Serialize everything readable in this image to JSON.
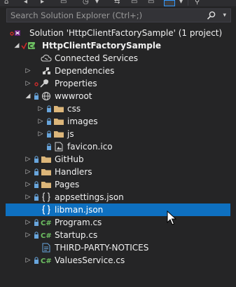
{
  "search": {
    "placeholder": "Search Solution Explorer (Ctrl+;)"
  },
  "tree": {
    "solution": "Solution 'HttpClientFactorySample' (1 project)",
    "project": "HttpClientFactorySample",
    "connected_services": "Connected Services",
    "dependencies": "Dependencies",
    "properties": "Properties",
    "wwwroot": "wwwroot",
    "css": "css",
    "images": "images",
    "js": "js",
    "favicon": "favicon.ico",
    "github": "GitHub",
    "handlers": "Handlers",
    "pages": "Pages",
    "appsettings": "appsettings.json",
    "libman": "libman.json",
    "program": "Program.cs",
    "startup": "Startup.cs",
    "third_party": "THIRD-PARTY-NOTICES",
    "values_service": "ValuesService.cs"
  },
  "colors": {
    "background": "#252526",
    "selection": "#0e70c0",
    "folder": "#dcb67a",
    "csharp": "#6dc062",
    "lock": "#68a5dc",
    "project_mark": "#c92b2b"
  }
}
